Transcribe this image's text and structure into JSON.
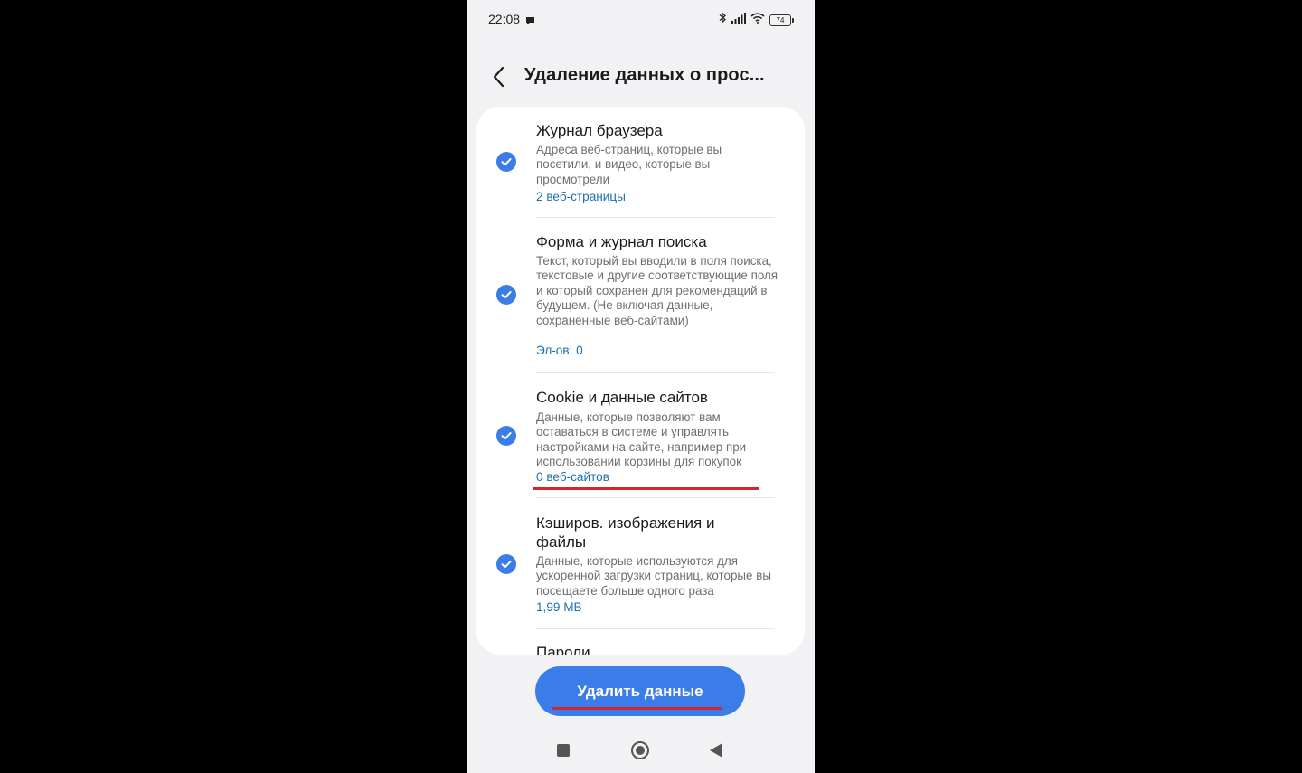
{
  "status_bar": {
    "time": "22:08",
    "battery": "74"
  },
  "header": {
    "title": "Удаление данных о прос..."
  },
  "options": [
    {
      "title": "Журнал браузера",
      "description": "Адреса веб-страниц, которые вы посетили, и видео, которые вы просмотрели",
      "count": "2 веб-страницы",
      "checked": true
    },
    {
      "title": "Форма и журнал поиска",
      "description": "Текст, который вы вводили в поля поиска, текстовые и другие соответствующие поля и который сохранен для рекомендаций в будущем. (Не включая данные, сохраненные веб-сайтами)",
      "count": "Эл-ов: 0",
      "checked": true
    },
    {
      "title": "Cookie и данные сайтов",
      "description": "Данные, которые позволяют вам оставаться в системе и управлять настройками на сайте, например при использовании корзины для покупок",
      "count": "0 веб-сайтов",
      "checked": true
    },
    {
      "title": "Кэширов. изображения и файлы",
      "description": "Данные, которые используются для ускоренной загрузки страниц, которые вы посещаете больше одного раза",
      "count": "1,99 MB",
      "checked": true
    },
    {
      "title": "Пароли"
    }
  ],
  "delete_button": {
    "label": "Удалить данные"
  },
  "colors": {
    "accent": "#3b7de8",
    "link": "#1f6fad",
    "highlight": "#d8232a",
    "background": "#f2f2f4"
  }
}
